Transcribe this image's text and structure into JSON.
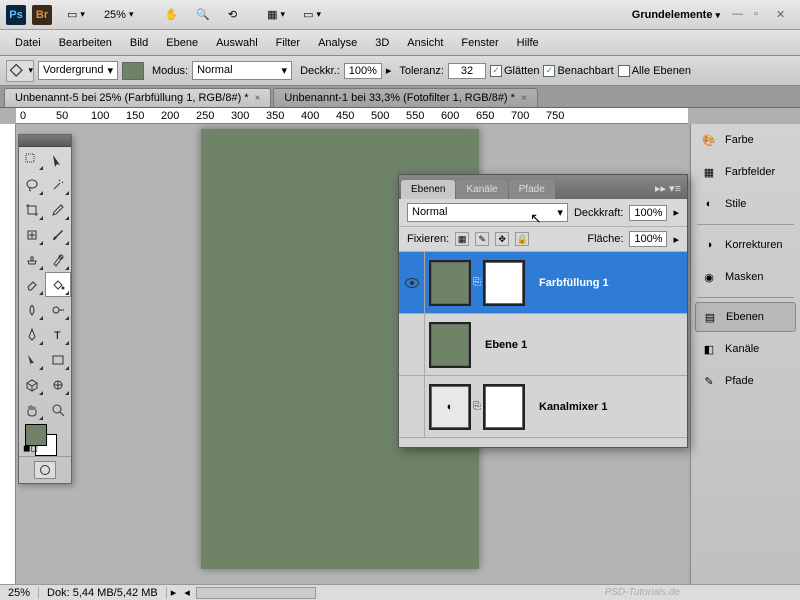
{
  "titlebar": {
    "zoom": "25%",
    "workspace": "Grundelemente"
  },
  "menu": [
    "Datei",
    "Bearbeiten",
    "Bild",
    "Ebene",
    "Auswahl",
    "Filter",
    "Analyse",
    "3D",
    "Ansicht",
    "Fenster",
    "Hilfe"
  ],
  "optbar": {
    "fill_target": "Vordergrund",
    "mode_label": "Modus:",
    "mode_value": "Normal",
    "opacity_label": "Deckkr.:",
    "opacity_value": "100%",
    "tolerance_label": "Toleranz:",
    "tolerance_value": "32",
    "smooth": "Glätten",
    "contiguous": "Benachbart",
    "all_layers": "Alle Ebenen"
  },
  "tabs": [
    {
      "title": "Unbenannt-5 bei 25% (Farbfüllung 1, RGB/8#) *",
      "active": true
    },
    {
      "title": "Unbenannt-1 bei 33,3% (Fotofilter 1, RGB/8#) *",
      "active": false
    }
  ],
  "ruler_marks": [
    "0",
    "50",
    "100",
    "150",
    "200",
    "250",
    "300",
    "350",
    "400",
    "450",
    "500",
    "550",
    "600",
    "650",
    "700",
    "750"
  ],
  "dock": {
    "farbe": "Farbe",
    "farbfelder": "Farbfelder",
    "stile": "Stile",
    "korrekturen": "Korrekturen",
    "masken": "Masken",
    "ebenen": "Ebenen",
    "kanaele": "Kanäle",
    "pfade": "Pfade"
  },
  "layers_panel": {
    "tabs": [
      "Ebenen",
      "Kanäle",
      "Pfade"
    ],
    "blend_mode": "Normal",
    "opacity_label": "Deckkraft:",
    "opacity": "100%",
    "lock_label": "Fixieren:",
    "fill_label": "Fläche:",
    "fill": "100%",
    "layers": [
      {
        "name": "Farbfüllung 1",
        "visible": true,
        "selected": true,
        "type": "fill"
      },
      {
        "name": "Ebene 1",
        "visible": false,
        "selected": false,
        "type": "raster"
      },
      {
        "name": "Kanalmixer 1",
        "visible": false,
        "selected": false,
        "type": "adjust"
      }
    ]
  },
  "status": {
    "zoom": "25%",
    "doc_info": "Dok: 5,44 MB/5,42 MB"
  },
  "colors": {
    "canvas": "#6f8368",
    "fg": "#6f8368",
    "bg": "#ffffff"
  },
  "watermark": "PSD-Tutorials.de"
}
